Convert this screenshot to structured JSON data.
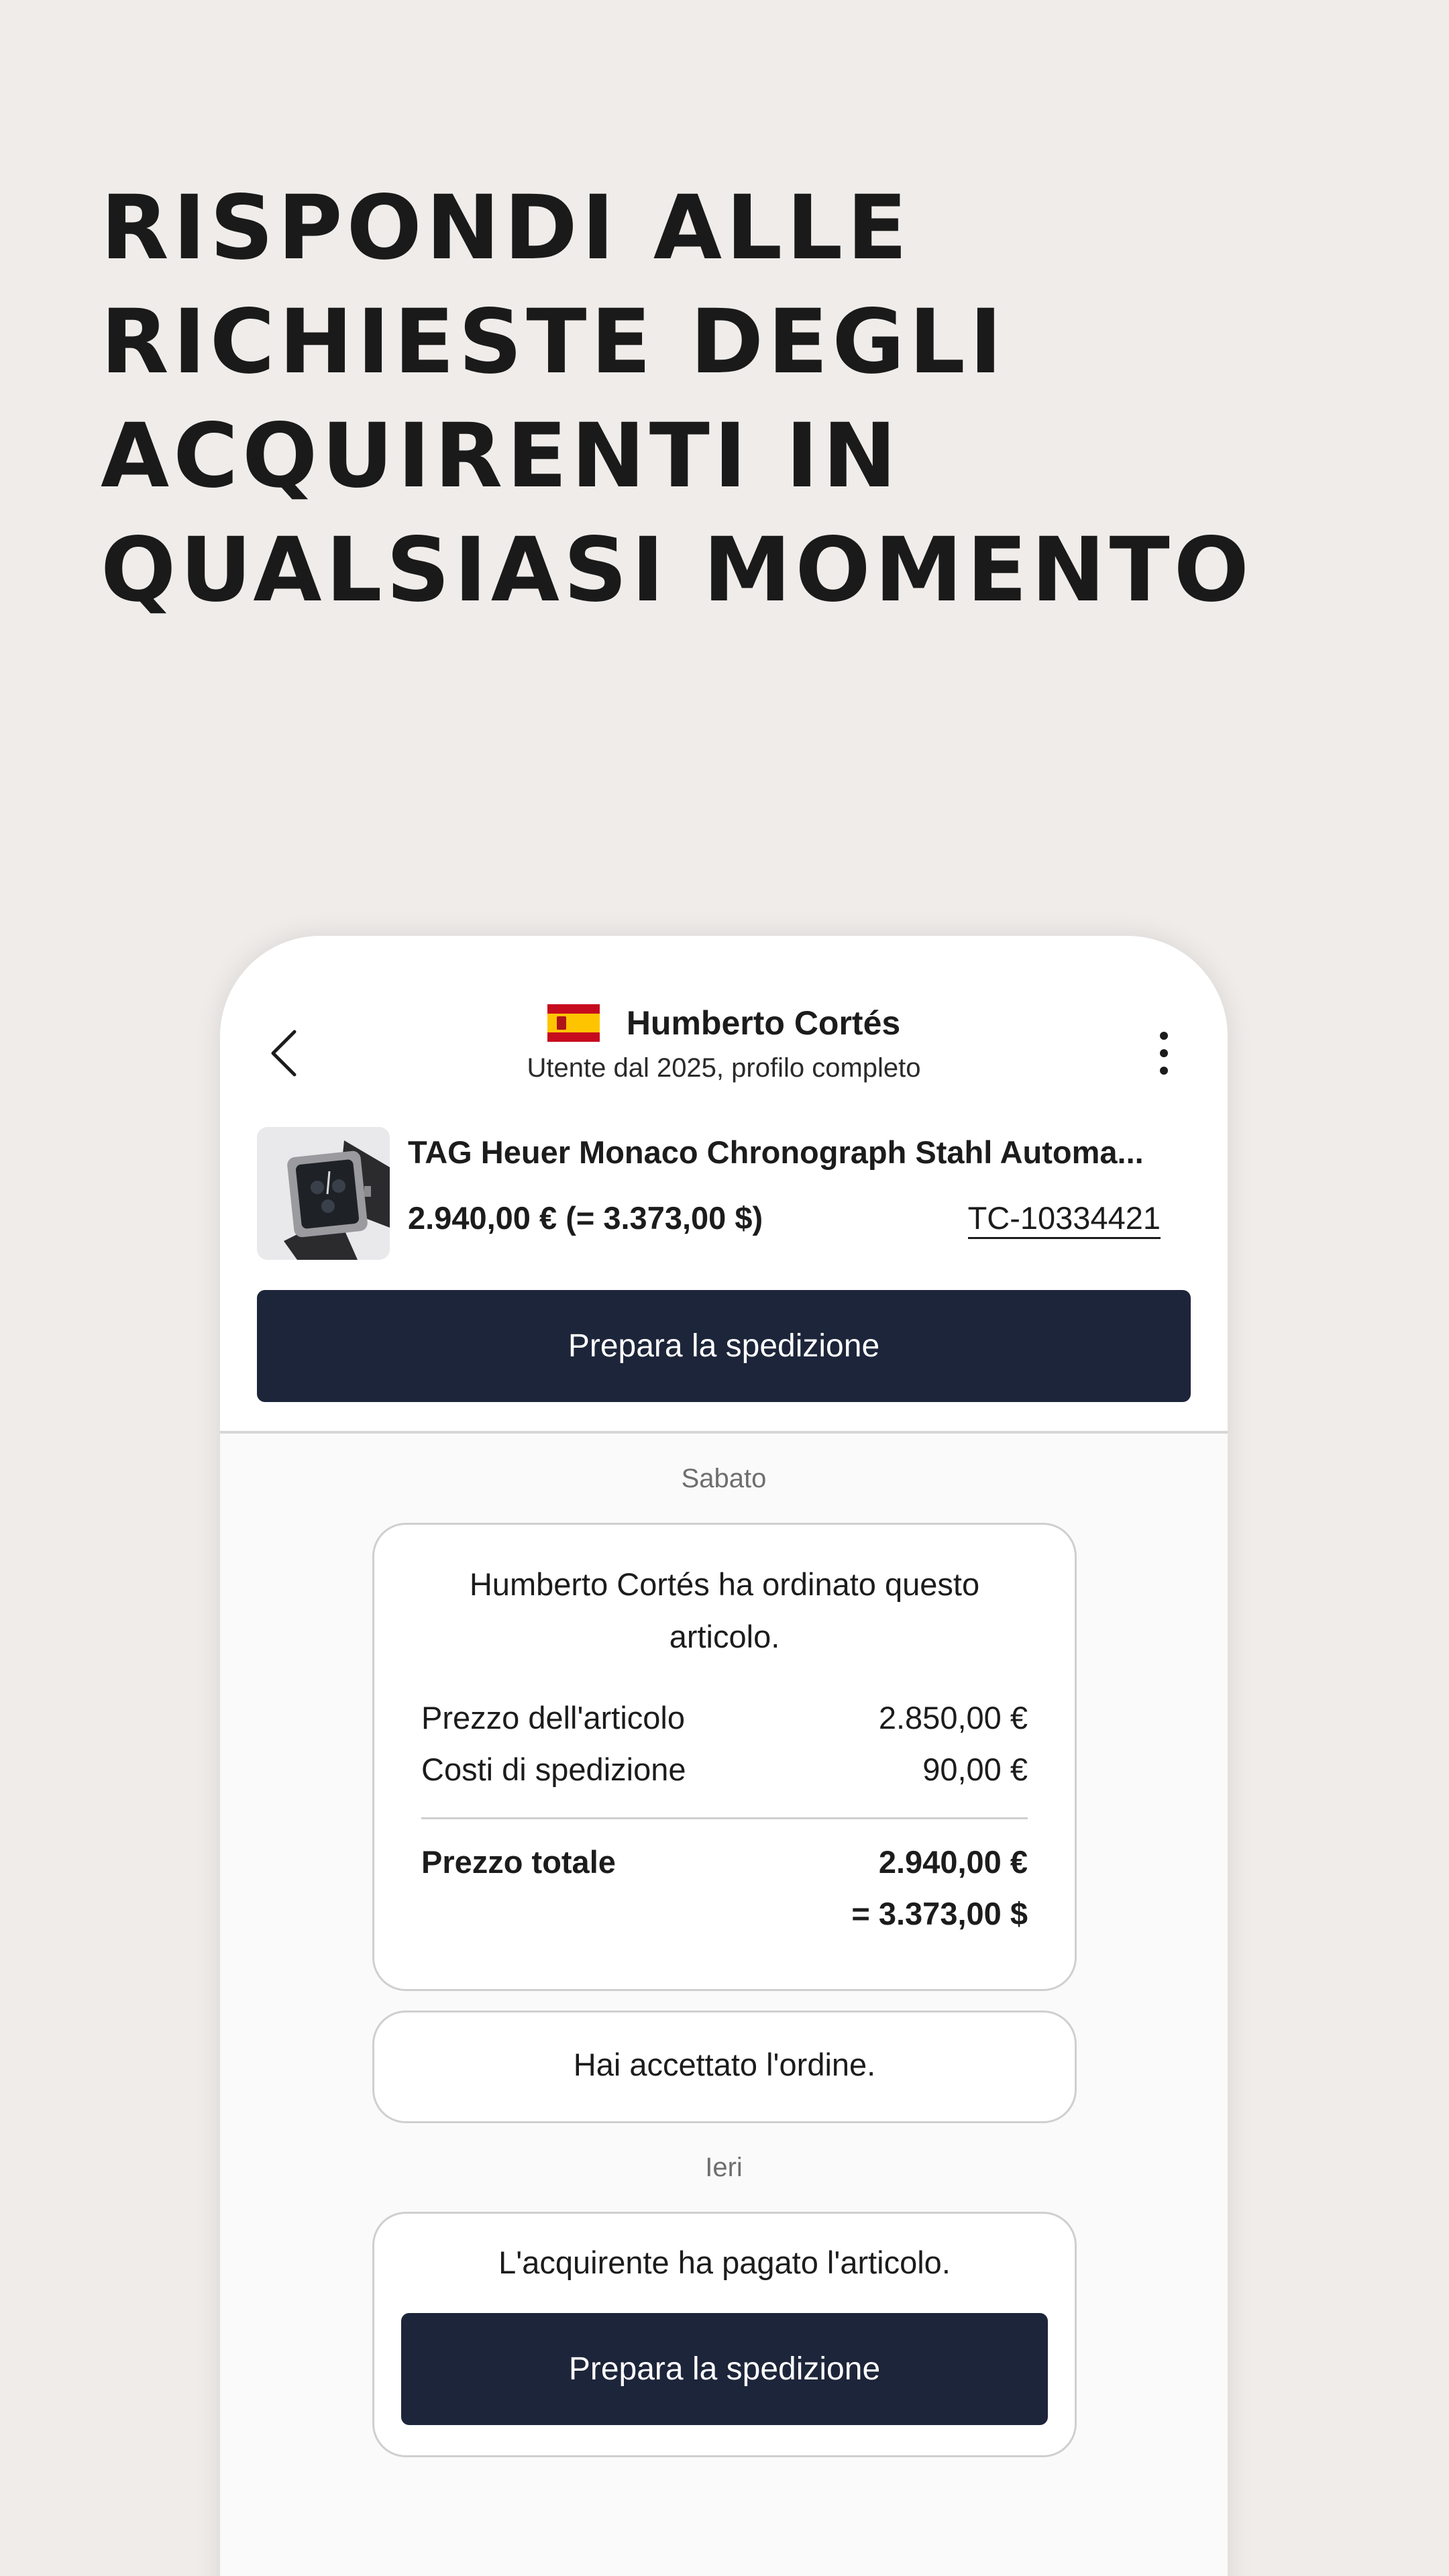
{
  "headline": {
    "lines": [
      "RISPONDI ALLE",
      "RICHIESTE DEGLI",
      "ACQUIRENTI IN",
      "QUALSIASI MOMENTO"
    ]
  },
  "header": {
    "back_icon": "chevron-left-icon",
    "more_icon": "more-vertical-icon",
    "flag": "spain-flag",
    "user_name": "Humberto Cortés",
    "user_subtitle": "Utente dal 2025, profilo completo"
  },
  "product": {
    "title": "TAG Heuer Monaco Chronograph Stahl Automa...",
    "price": "2.940,00 € (= 3.373,00 $)",
    "reference": "TC-10334421",
    "thumbnail": "watch-image"
  },
  "primary_action": {
    "label": "Prepara la spedizione"
  },
  "chat": {
    "day1": "Sabato",
    "order_message": "Humberto Cortés ha ordinato questo articolo.",
    "item_price_label": "Prezzo dell'articolo",
    "item_price_value": "2.850,00 €",
    "shipping_label": "Costi di spedizione",
    "shipping_value": "90,00 €",
    "total_label": "Prezzo totale",
    "total_value": "2.940,00 €",
    "total_usd": "= 3.373,00 $",
    "accepted_message": "Hai accettato l'ordine.",
    "day2": "Ieri",
    "paid_message": "L'acquirente ha pagato l'articolo.",
    "paid_button_label": "Prepara la spedizione"
  },
  "colors": {
    "background": "#efecea",
    "primary_button": "#1d253a",
    "card_border": "#cfcfcf"
  }
}
